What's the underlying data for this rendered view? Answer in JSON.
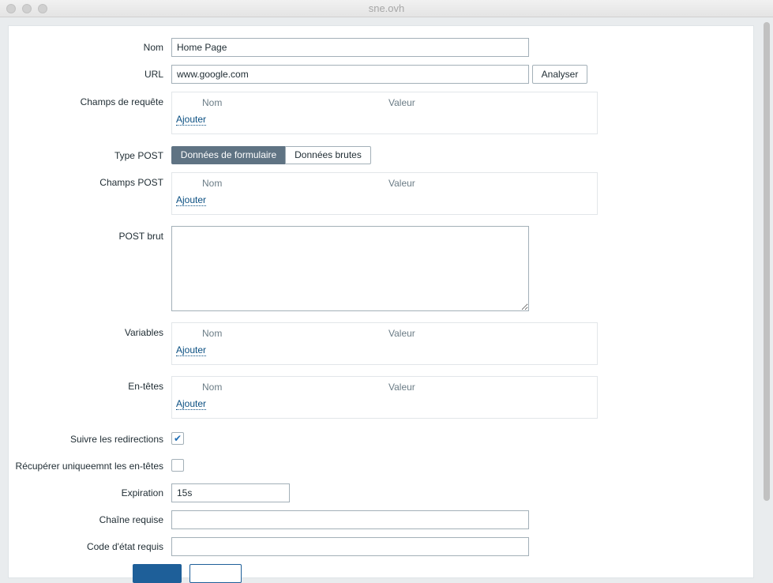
{
  "window": {
    "title": "sne.ovh"
  },
  "form": {
    "nom": {
      "label": "Nom",
      "value": "Home Page"
    },
    "url": {
      "label": "URL",
      "value": "www.google.com",
      "analyze": "Analyser"
    },
    "query_fields": {
      "label": "Champs de requête",
      "col_name": "Nom",
      "col_value": "Valeur",
      "add": "Ajouter"
    },
    "post_type": {
      "label": "Type POST",
      "options": [
        "Données de formulaire",
        "Données brutes"
      ],
      "selected": "Données de formulaire"
    },
    "post_fields": {
      "label": "Champs POST",
      "col_name": "Nom",
      "col_value": "Valeur",
      "add": "Ajouter"
    },
    "raw_post": {
      "label": "POST brut",
      "value": ""
    },
    "variables": {
      "label": "Variables",
      "col_name": "Nom",
      "col_value": "Valeur",
      "add": "Ajouter"
    },
    "headers": {
      "label": "En-têtes",
      "col_name": "Nom",
      "col_value": "Valeur",
      "add": "Ajouter"
    },
    "follow_redirects": {
      "label": "Suivre les redirections",
      "checked": true,
      "mark": "✔"
    },
    "headers_only": {
      "label": "Récupérer uniqueemnt les en-têtes",
      "checked": false
    },
    "timeout": {
      "label": "Expiration",
      "value": "15s"
    },
    "required_string": {
      "label": "Chaîne requise",
      "value": ""
    },
    "required_status": {
      "label": "Code d'état requis",
      "value": ""
    }
  }
}
